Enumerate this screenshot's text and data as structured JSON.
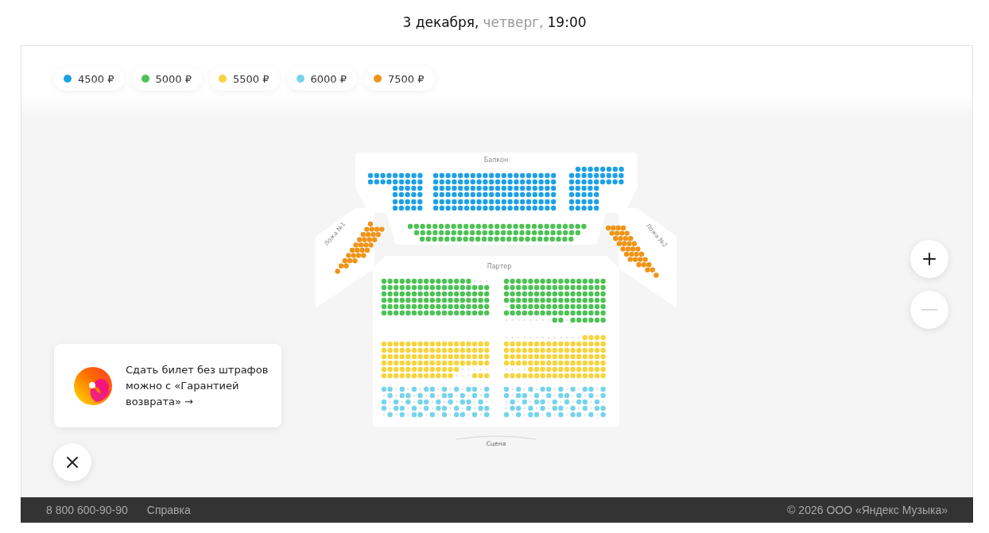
{
  "header": {
    "date": "3 декабря,",
    "weekday": "четверг,",
    "time": "19:00"
  },
  "legend": [
    {
      "label": "4500 ₽",
      "color": "#1da1e6"
    },
    {
      "label": "5000 ₽",
      "color": "#4cc354"
    },
    {
      "label": "5500 ₽",
      "color": "#f7d43a"
    },
    {
      "label": "6000 ₽",
      "color": "#76d4ec"
    },
    {
      "label": "7500 ₽",
      "color": "#ef9418"
    }
  ],
  "hall": {
    "balcony": "Балкон",
    "box_left": "Ложа №1",
    "box_right": "Ложа №2",
    "stalls": "Партер",
    "stage": "Сцена"
  },
  "zoom": [
    {
      "kind": "in",
      "disabled": false
    },
    {
      "kind": "out",
      "disabled": true
    }
  ],
  "promo": {
    "text": "Сдать билет без штрафов можно с «Гарантией возврата» →"
  },
  "footer": {
    "phone": "8 800 600-90-90",
    "help": "Справка",
    "copyright": "© 2026 ООО «Яндекс Музыка»"
  }
}
